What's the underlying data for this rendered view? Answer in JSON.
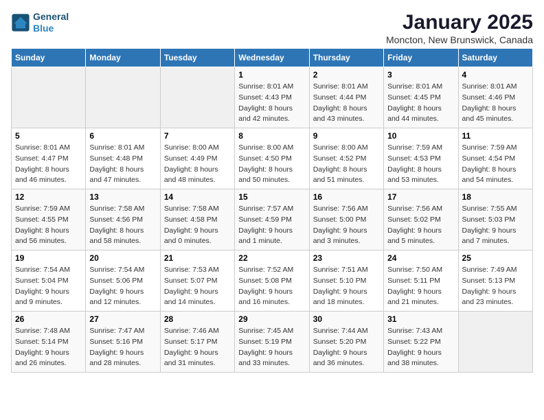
{
  "logo": {
    "line1": "General",
    "line2": "Blue"
  },
  "title": "January 2025",
  "subtitle": "Moncton, New Brunswick, Canada",
  "days_of_week": [
    "Sunday",
    "Monday",
    "Tuesday",
    "Wednesday",
    "Thursday",
    "Friday",
    "Saturday"
  ],
  "weeks": [
    [
      {
        "day": "",
        "info": ""
      },
      {
        "day": "",
        "info": ""
      },
      {
        "day": "",
        "info": ""
      },
      {
        "day": "1",
        "info": "Sunrise: 8:01 AM\nSunset: 4:43 PM\nDaylight: 8 hours and 42 minutes."
      },
      {
        "day": "2",
        "info": "Sunrise: 8:01 AM\nSunset: 4:44 PM\nDaylight: 8 hours and 43 minutes."
      },
      {
        "day": "3",
        "info": "Sunrise: 8:01 AM\nSunset: 4:45 PM\nDaylight: 8 hours and 44 minutes."
      },
      {
        "day": "4",
        "info": "Sunrise: 8:01 AM\nSunset: 4:46 PM\nDaylight: 8 hours and 45 minutes."
      }
    ],
    [
      {
        "day": "5",
        "info": "Sunrise: 8:01 AM\nSunset: 4:47 PM\nDaylight: 8 hours and 46 minutes."
      },
      {
        "day": "6",
        "info": "Sunrise: 8:01 AM\nSunset: 4:48 PM\nDaylight: 8 hours and 47 minutes."
      },
      {
        "day": "7",
        "info": "Sunrise: 8:00 AM\nSunset: 4:49 PM\nDaylight: 8 hours and 48 minutes."
      },
      {
        "day": "8",
        "info": "Sunrise: 8:00 AM\nSunset: 4:50 PM\nDaylight: 8 hours and 50 minutes."
      },
      {
        "day": "9",
        "info": "Sunrise: 8:00 AM\nSunset: 4:52 PM\nDaylight: 8 hours and 51 minutes."
      },
      {
        "day": "10",
        "info": "Sunrise: 7:59 AM\nSunset: 4:53 PM\nDaylight: 8 hours and 53 minutes."
      },
      {
        "day": "11",
        "info": "Sunrise: 7:59 AM\nSunset: 4:54 PM\nDaylight: 8 hours and 54 minutes."
      }
    ],
    [
      {
        "day": "12",
        "info": "Sunrise: 7:59 AM\nSunset: 4:55 PM\nDaylight: 8 hours and 56 minutes."
      },
      {
        "day": "13",
        "info": "Sunrise: 7:58 AM\nSunset: 4:56 PM\nDaylight: 8 hours and 58 minutes."
      },
      {
        "day": "14",
        "info": "Sunrise: 7:58 AM\nSunset: 4:58 PM\nDaylight: 9 hours and 0 minutes."
      },
      {
        "day": "15",
        "info": "Sunrise: 7:57 AM\nSunset: 4:59 PM\nDaylight: 9 hours and 1 minute."
      },
      {
        "day": "16",
        "info": "Sunrise: 7:56 AM\nSunset: 5:00 PM\nDaylight: 9 hours and 3 minutes."
      },
      {
        "day": "17",
        "info": "Sunrise: 7:56 AM\nSunset: 5:02 PM\nDaylight: 9 hours and 5 minutes."
      },
      {
        "day": "18",
        "info": "Sunrise: 7:55 AM\nSunset: 5:03 PM\nDaylight: 9 hours and 7 minutes."
      }
    ],
    [
      {
        "day": "19",
        "info": "Sunrise: 7:54 AM\nSunset: 5:04 PM\nDaylight: 9 hours and 9 minutes."
      },
      {
        "day": "20",
        "info": "Sunrise: 7:54 AM\nSunset: 5:06 PM\nDaylight: 9 hours and 12 minutes."
      },
      {
        "day": "21",
        "info": "Sunrise: 7:53 AM\nSunset: 5:07 PM\nDaylight: 9 hours and 14 minutes."
      },
      {
        "day": "22",
        "info": "Sunrise: 7:52 AM\nSunset: 5:08 PM\nDaylight: 9 hours and 16 minutes."
      },
      {
        "day": "23",
        "info": "Sunrise: 7:51 AM\nSunset: 5:10 PM\nDaylight: 9 hours and 18 minutes."
      },
      {
        "day": "24",
        "info": "Sunrise: 7:50 AM\nSunset: 5:11 PM\nDaylight: 9 hours and 21 minutes."
      },
      {
        "day": "25",
        "info": "Sunrise: 7:49 AM\nSunset: 5:13 PM\nDaylight: 9 hours and 23 minutes."
      }
    ],
    [
      {
        "day": "26",
        "info": "Sunrise: 7:48 AM\nSunset: 5:14 PM\nDaylight: 9 hours and 26 minutes."
      },
      {
        "day": "27",
        "info": "Sunrise: 7:47 AM\nSunset: 5:16 PM\nDaylight: 9 hours and 28 minutes."
      },
      {
        "day": "28",
        "info": "Sunrise: 7:46 AM\nSunset: 5:17 PM\nDaylight: 9 hours and 31 minutes."
      },
      {
        "day": "29",
        "info": "Sunrise: 7:45 AM\nSunset: 5:19 PM\nDaylight: 9 hours and 33 minutes."
      },
      {
        "day": "30",
        "info": "Sunrise: 7:44 AM\nSunset: 5:20 PM\nDaylight: 9 hours and 36 minutes."
      },
      {
        "day": "31",
        "info": "Sunrise: 7:43 AM\nSunset: 5:22 PM\nDaylight: 9 hours and 38 minutes."
      },
      {
        "day": "",
        "info": ""
      }
    ]
  ]
}
